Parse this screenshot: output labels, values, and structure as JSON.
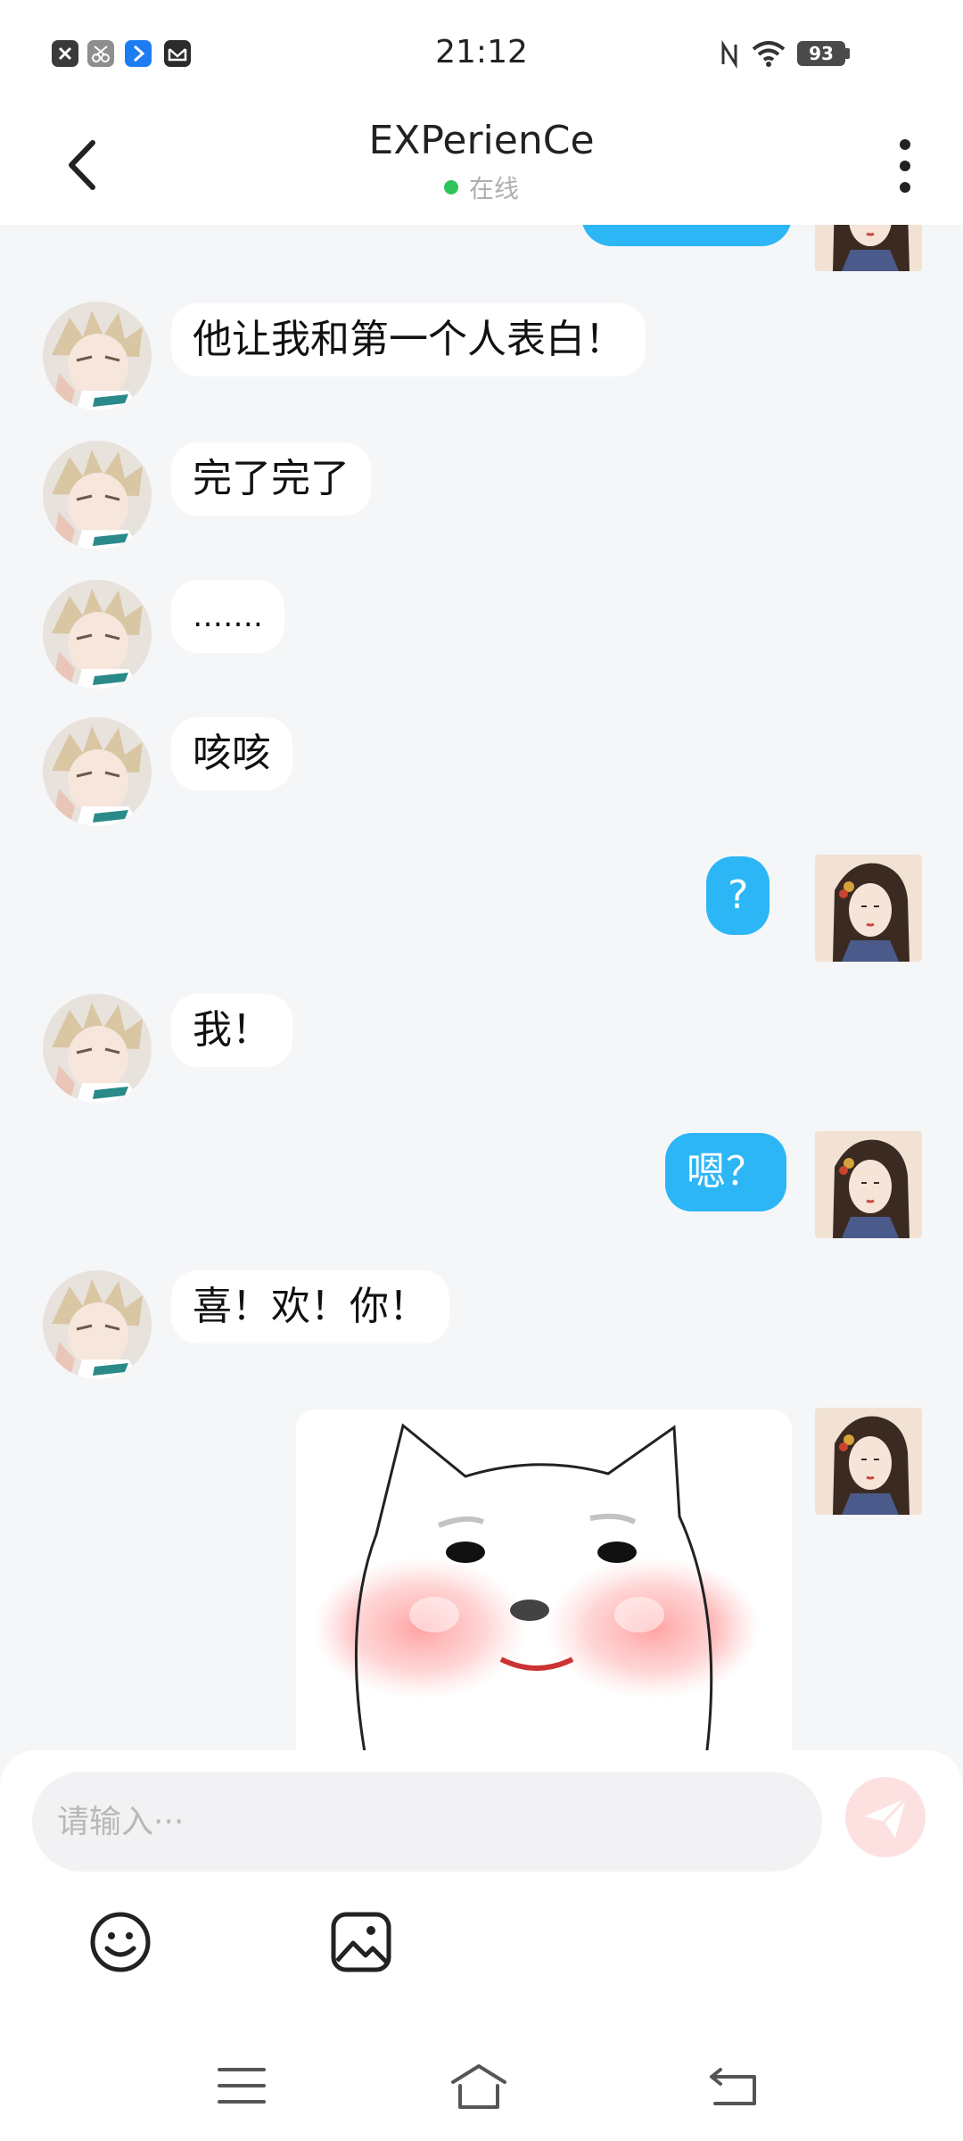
{
  "status_bar": {
    "time": "21:12",
    "battery": "93",
    "app_icons": [
      "close-app-icon",
      "scissors-app-icon",
      "blue-app-icon",
      "mail-app-icon"
    ],
    "right_icons": [
      "nfc-icon",
      "wifi-icon",
      "battery-icon"
    ]
  },
  "header": {
    "contact_name": "EXPerienCe",
    "status": "在线",
    "status_color": "#2ec45a"
  },
  "messages": [
    {
      "side": "out",
      "text": ""
    },
    {
      "side": "in",
      "text": "他让我和第一个人表白！"
    },
    {
      "side": "in",
      "text": "完了完了"
    },
    {
      "side": "in",
      "text": "……."
    },
    {
      "side": "in",
      "text": "咳咳"
    },
    {
      "side": "out",
      "text": "?"
    },
    {
      "side": "in",
      "text": "我！"
    },
    {
      "side": "out",
      "text": "嗯？"
    },
    {
      "side": "in",
      "text": "喜！欢！你！"
    },
    {
      "side": "out",
      "type": "sticker",
      "sticker": "blushing-cat-face"
    }
  ],
  "input": {
    "placeholder": "请输入···",
    "value": ""
  },
  "toolbar_icons": [
    "emoji-icon",
    "image-icon"
  ],
  "nav_icons": [
    "menu-icon",
    "home-icon",
    "back-icon"
  ],
  "colors": {
    "outgoing_bubble": "#2cb6f6",
    "incoming_bubble": "#ffffff",
    "background": "#f5f6f8",
    "send_button": "#fde1e1"
  }
}
